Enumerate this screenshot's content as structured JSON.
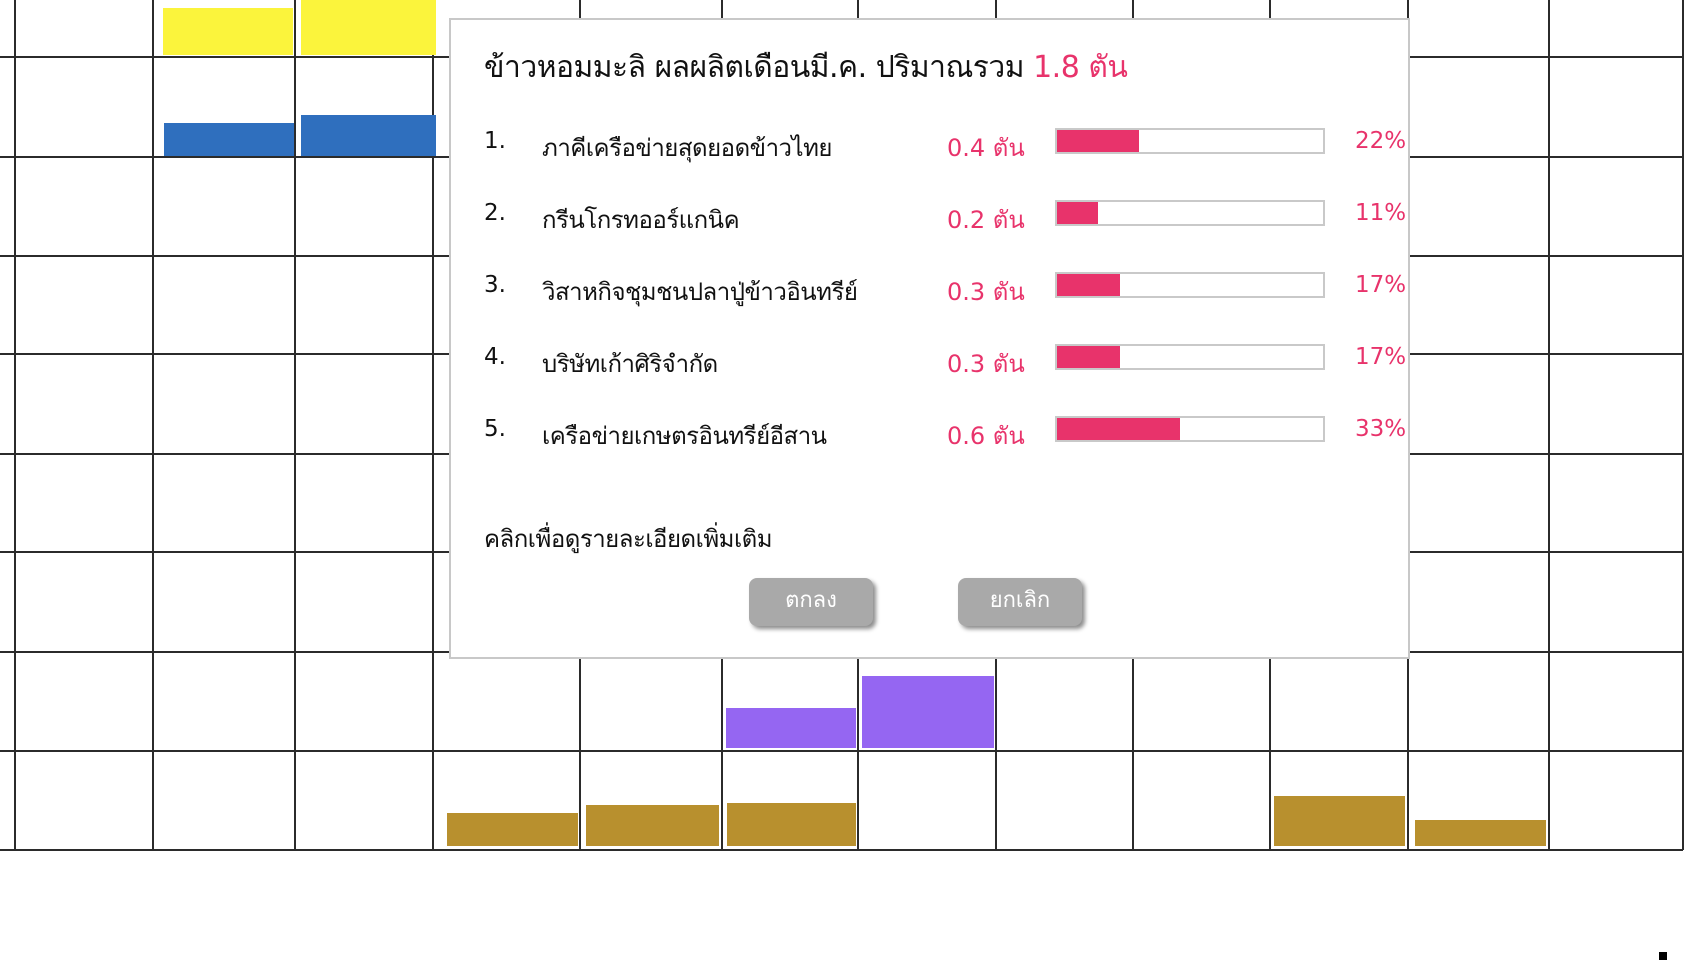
{
  "background_grid": {
    "colors": {
      "grid": "#2b2b2b",
      "yellow": "#fbf43c",
      "blue": "#2f6fbe",
      "purple": "#9566f2",
      "gold": "#b8902e"
    }
  },
  "dialog": {
    "title_prefix": "ข้าวหอมมะลิ ผลผลิตเดือนมี.ค. ปริมาณรวม",
    "title_total": "1.8 ตัน",
    "items": [
      {
        "rank": "1.",
        "name": "ภาคีเครือข่ายสุดยอดข้าวไทย",
        "qty": "0.4 ตัน",
        "share": 0.22,
        "pct": "22%"
      },
      {
        "rank": "2.",
        "name": "กรีนโกรทออร์แกนิค",
        "qty": "0.2 ตัน",
        "share": 0.11,
        "pct": "11%"
      },
      {
        "rank": "3.",
        "name": "วิสาหกิจชุมชนปลาปู่ข้าวอินทรีย์",
        "qty": "0.3 ตัน",
        "share": 0.17,
        "pct": "17%"
      },
      {
        "rank": "4.",
        "name": "บริษัทเก้าศิริจำกัด",
        "qty": "0.3 ตัน",
        "share": 0.17,
        "pct": "17%"
      },
      {
        "rank": "5.",
        "name": "เครือข่ายเกษตรอินทรีย์อีสาน",
        "qty": "0.6 ตัน",
        "share": 0.33,
        "pct": "33%"
      }
    ],
    "note": "คลิกเพื่อดูรายละเอียดเพิ่มเติม",
    "ok_label": "ตกลง",
    "cancel_label": "ยกเลิก",
    "accent_color": "#e8336b",
    "button_color": "#a9a9a9"
  }
}
